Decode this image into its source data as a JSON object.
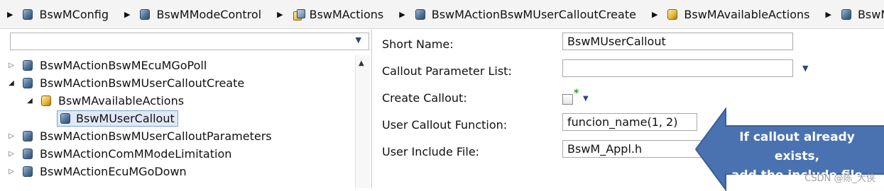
{
  "breadcrumb": [
    {
      "label": "BswMConfig",
      "icon": "container-icon"
    },
    {
      "label": "BswMModeControl",
      "icon": "container-icon"
    },
    {
      "label": "BswMActions",
      "icon": "multi-container-icon"
    },
    {
      "label": "BswMActionBswMUserCalloutCreate",
      "icon": "container-icon"
    },
    {
      "label": "BswMAvailableActions",
      "icon": "choice-container-icon"
    },
    {
      "label": "BswM",
      "icon": "container-icon"
    }
  ],
  "tree": [
    {
      "label": "BswMActionBswMEcuMGoPoll",
      "state": "collapsed",
      "icon": "container-icon"
    },
    {
      "label": "BswMActionBswMUserCalloutCreate",
      "state": "expanded",
      "icon": "container-icon"
    },
    {
      "label": "BswMAvailableActions",
      "state": "expanded",
      "icon": "choice-container-icon"
    },
    {
      "label": "BswMUserCallout",
      "state": "leaf",
      "icon": "container-icon",
      "selected": true
    },
    {
      "label": "BswMActionBswMUserCalloutParameters",
      "state": "collapsed",
      "icon": "container-icon"
    },
    {
      "label": "BswMActionComMModeLimitation",
      "state": "collapsed",
      "icon": "container-icon"
    },
    {
      "label": "BswMActionEcuMGoDown",
      "state": "collapsed",
      "icon": "container-icon"
    }
  ],
  "form": {
    "short_name": {
      "label": "Short Name:",
      "value": "BswMUserCallout"
    },
    "callout_param_list": {
      "label": "Callout Parameter List:",
      "value": ""
    },
    "create_callout": {
      "label": "Create Callout:",
      "checked": false
    },
    "user_callout_function": {
      "label": "User Callout Function:",
      "value": "funcion_name(1, 2)"
    },
    "user_include_file": {
      "label": "User Include File:",
      "value": "BswM_Appl.h"
    }
  },
  "callout_note": {
    "line1": "If callout already exists,",
    "line2": "add the include file",
    "color": "#4a72b0"
  },
  "watermark": "CSDN @陈_大侠"
}
